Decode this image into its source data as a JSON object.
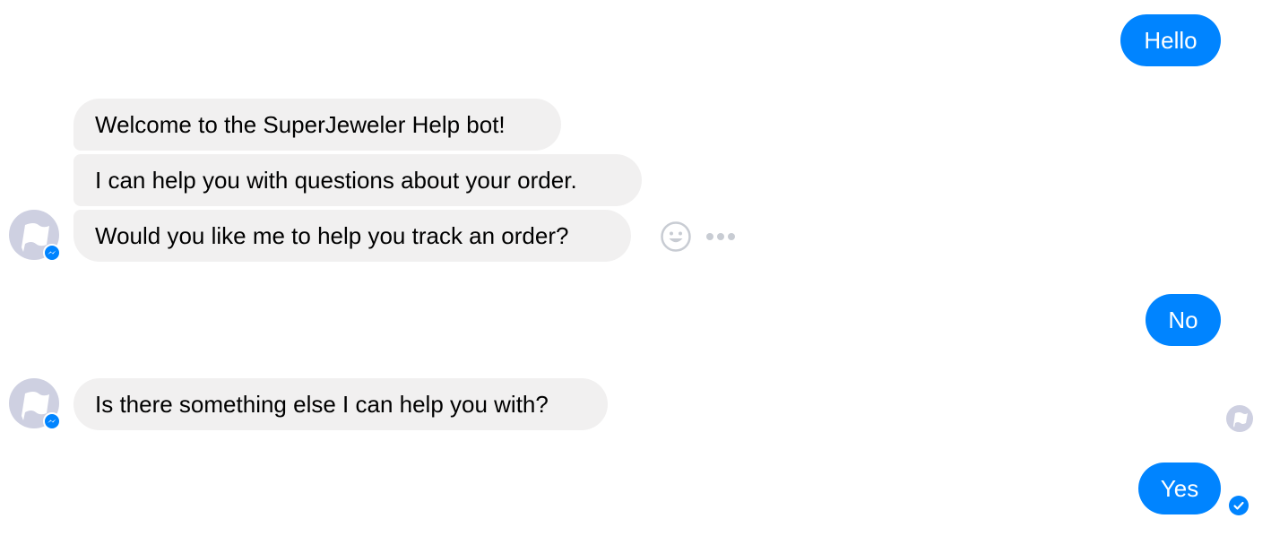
{
  "conversation": {
    "messages": [
      {
        "sender": "user",
        "text": "Hello"
      },
      {
        "sender": "bot",
        "text": "Welcome to the SuperJeweler Help bot!"
      },
      {
        "sender": "bot",
        "text": "I can help you with questions about your order."
      },
      {
        "sender": "bot",
        "text": "Would you like me to help you track an order?"
      },
      {
        "sender": "user",
        "text": "No"
      },
      {
        "sender": "bot",
        "text": "Is there something else I can help you with?"
      },
      {
        "sender": "user",
        "text": "Yes"
      }
    ]
  },
  "icons": {
    "bot_avatar": "flag-avatar-icon",
    "avatar_badge": "messenger-badge-icon",
    "react": "smiley-react-icon",
    "more": "more-options-icon",
    "seen": "seen-avatar-icon",
    "delivered": "delivered-check-icon"
  },
  "colors": {
    "outgoing_bubble": "#0084ff",
    "incoming_bubble": "#f1f0f0",
    "avatar_bg": "#ced0e1",
    "icon_gray": "#c8ccd3"
  }
}
